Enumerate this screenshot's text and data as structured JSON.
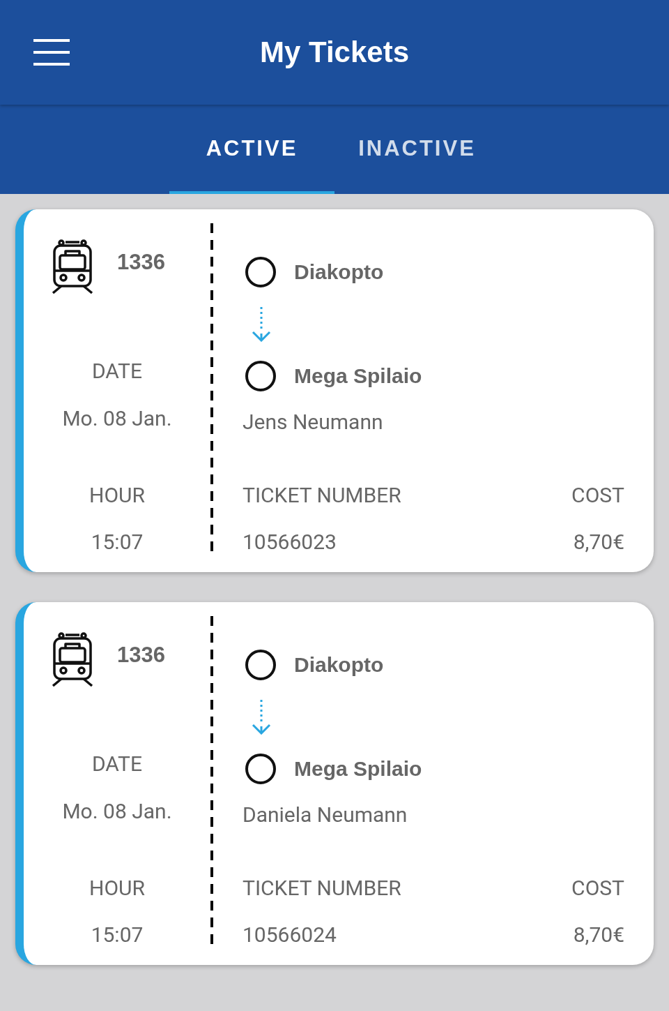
{
  "header": {
    "title": "My Tickets"
  },
  "tabs": [
    {
      "label": "ACTIVE",
      "selected": true
    },
    {
      "label": "INACTIVE",
      "selected": false
    }
  ],
  "tickets": [
    {
      "train": "1336",
      "date_label": "DATE",
      "date": "Mo. 08 Jan.",
      "hour_label": "HOUR",
      "hour": "15:07",
      "from": "Diakopto",
      "to": "Mega Spilaio",
      "passenger": "Jens Neumann",
      "ticket_number_label": "TICKET NUMBER",
      "ticket_number": "10566023",
      "cost_label": "COST",
      "cost": "8,70€"
    },
    {
      "train": "1336",
      "date_label": "DATE",
      "date": "Mo. 08 Jan.",
      "hour_label": "HOUR",
      "hour": "15:07",
      "from": "Diakopto",
      "to": "Mega Spilaio",
      "passenger": "Daniela Neumann",
      "ticket_number_label": "TICKET NUMBER",
      "ticket_number": "10566024",
      "cost_label": "COST",
      "cost": "8,70€"
    }
  ]
}
